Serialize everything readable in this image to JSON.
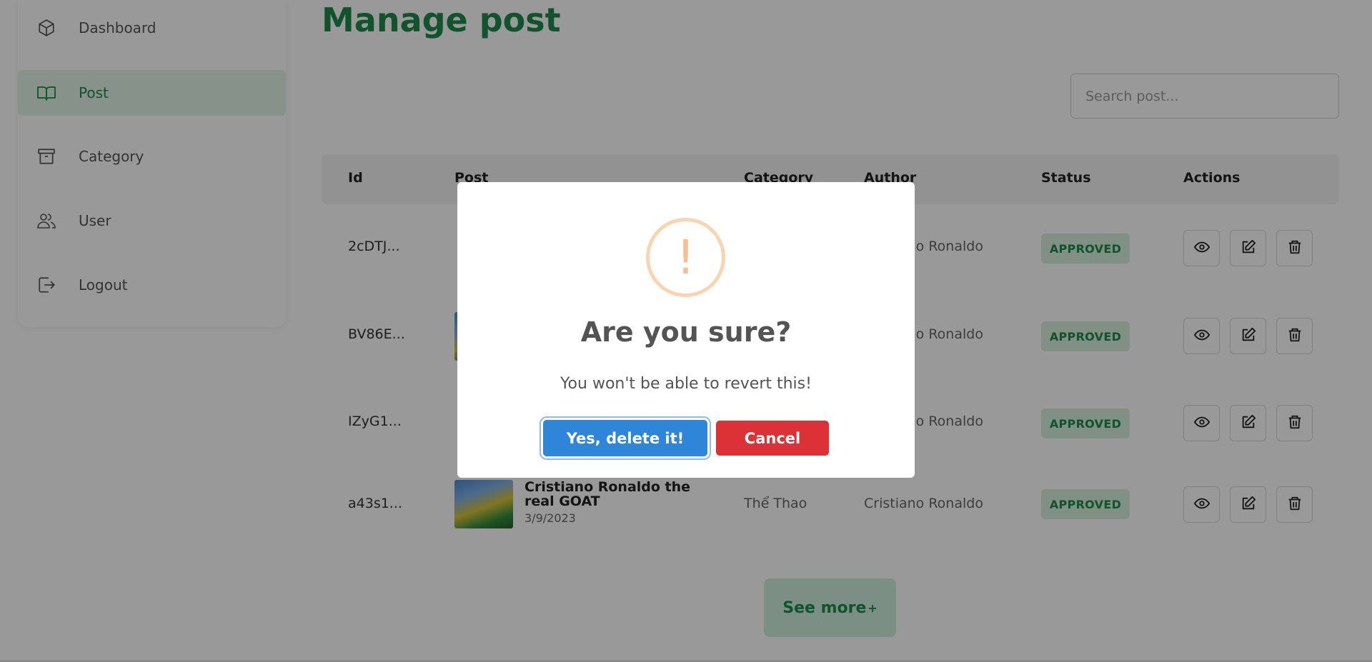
{
  "sidebar": {
    "items": [
      {
        "label": "Dashboard",
        "icon": "cube-icon"
      },
      {
        "label": "Post",
        "icon": "book-icon",
        "active": true
      },
      {
        "label": "Category",
        "icon": "archive-icon"
      },
      {
        "label": "User",
        "icon": "users-icon"
      },
      {
        "label": "Logout",
        "icon": "logout-icon"
      }
    ]
  },
  "page": {
    "title": "Manage post",
    "search_placeholder": "Search post..."
  },
  "table": {
    "headers": [
      "Id",
      "Post",
      "Category",
      "Author",
      "Status",
      "Actions"
    ],
    "rows": [
      {
        "id": "2cDTJ...",
        "author": "Cristiano Ronaldo",
        "status": "APPROVED"
      },
      {
        "id": "BV86E...",
        "author": "Cristiano Ronaldo",
        "status": "APPROVED"
      },
      {
        "id": "IZyG1...",
        "author": "Cristiano Ronaldo",
        "status": "APPROVED"
      },
      {
        "id": "a43s1...",
        "post_title": "Cristiano Ronaldo the real GOAT",
        "post_date": "3/9/2023",
        "category": "Thể Thao",
        "author": "Cristiano Ronaldo",
        "status": "APPROVED"
      }
    ]
  },
  "see_more": {
    "label": "See more",
    "suffix": "+"
  },
  "modal": {
    "icon": "!",
    "title": "Are you sure?",
    "text": "You won't be able to revert this!",
    "confirm_label": "Yes, delete it!",
    "cancel_label": "Cancel"
  },
  "colors": {
    "brand": "#1b8a4a",
    "confirm": "#2f86d8",
    "cancel": "#dc3237",
    "warning": "#f8bb86"
  }
}
